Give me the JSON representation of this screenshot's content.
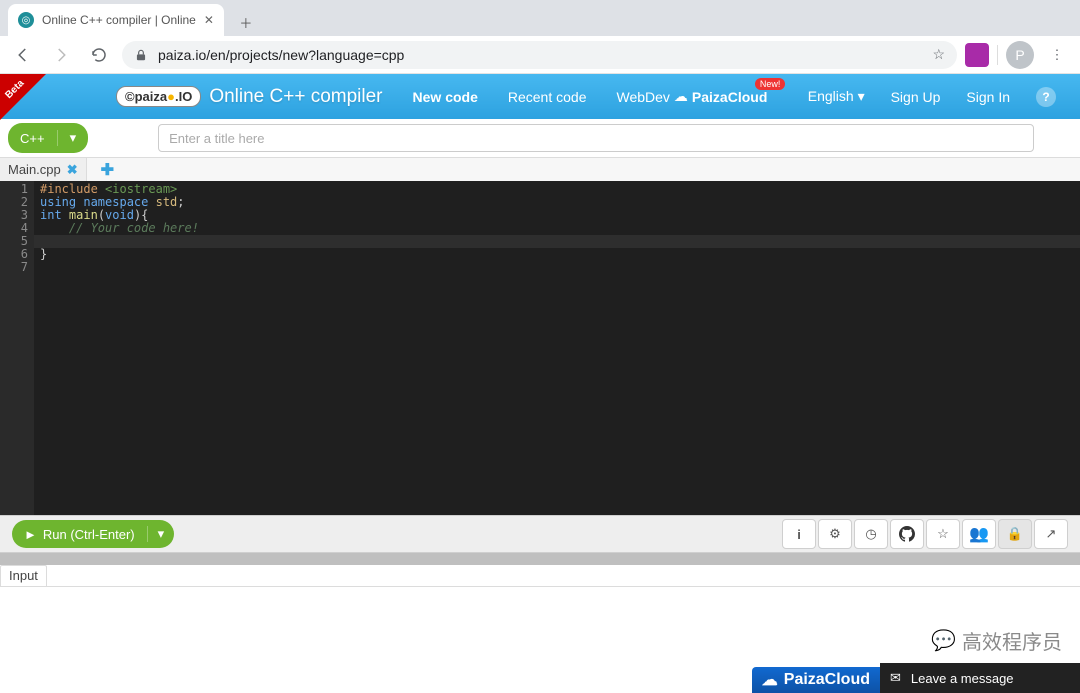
{
  "browser": {
    "tab_title": "Online C++ compiler | Online",
    "url": "paiza.io/en/projects/new?language=cpp",
    "profile_letter": "P"
  },
  "header": {
    "beta": "Beta",
    "brand": "paiza",
    "brand_suffix": ".IO",
    "title": "Online C++ compiler",
    "nav": {
      "new_code": "New code",
      "recent_code": "Recent code",
      "webdev": "WebDev",
      "paizacloud": "PaizaCloud",
      "new_badge": "New!"
    },
    "right": {
      "language": "English",
      "signup": "Sign Up",
      "signin": "Sign In"
    }
  },
  "langrow": {
    "language_button": "C++",
    "title_placeholder": "Enter a title here"
  },
  "filetab": {
    "name": "Main.cpp"
  },
  "editor": {
    "lines": [
      "1",
      "2",
      "3",
      "4",
      "5",
      "6",
      "7"
    ],
    "code": {
      "l1_a": "#include ",
      "l1_b": "<iostream>",
      "l2_a": "using ",
      "l2_b": "namespace ",
      "l2_c": "std",
      "l2_d": ";",
      "l3_a": "int ",
      "l3_b": "main",
      "l3_c": "(",
      "l3_d": "void",
      "l3_e": "){",
      "l4": "    // Your code here!",
      "l5": "",
      "l6": "}"
    }
  },
  "runbar": {
    "run_label": "Run (Ctrl-Enter)"
  },
  "io": {
    "input_tab": "Input"
  },
  "footer": {
    "paizacloud": "PaizaCloud",
    "leave_msg": "Leave a message",
    "wechat": "高效程序员"
  }
}
